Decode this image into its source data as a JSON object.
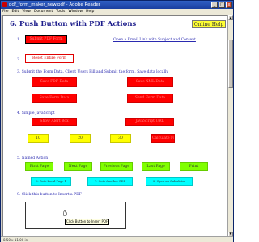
{
  "window": {
    "title": "pdf_form_maker_new.pdf - Adobe Reader",
    "min_label": "_",
    "max_label": "□",
    "close_label": "x"
  },
  "menubar": {
    "items": [
      "File",
      "Edit",
      "View",
      "Document",
      "Tools",
      "Window",
      "Help"
    ]
  },
  "heading": {
    "title": "6. Push Button with PDF Actions",
    "online_help": "Online Help"
  },
  "section1": {
    "num": "1.",
    "red_button_label": "Submit PDF Form",
    "email_link": "Open a Email Link with Subject and Content"
  },
  "section2": {
    "num": "2.",
    "reset_label": "Reset Entire Form"
  },
  "section3": {
    "text": "3. Submit the Form Data. Client Users Fill and Submit the form, Save data locally",
    "buttons": [
      "Save FDF Data",
      "Save XML Data",
      "Save Form Data",
      "Send Form Data"
    ]
  },
  "section4": {
    "text": "4. Simple JavaScript",
    "left_button": "Show Alert Box",
    "right_button": "JavaScript URL",
    "yellow_buttons": [
      "10",
      "20",
      "30"
    ],
    "right_button2": "Calculate Field"
  },
  "section5": {
    "text": "5. Named Action",
    "green_buttons": [
      "First Page",
      "Next Page",
      "Previous Page",
      "Last Page",
      "Print"
    ],
    "cyan_buttons": [
      "6. Goto Local Page 1",
      "7. Goto Another PDF",
      "8. Open an Calculator"
    ]
  },
  "section9": {
    "text": "9. Click this button to Insert a PDF",
    "tooltip": "Click Button to Insert PDF"
  },
  "statusbar": {
    "text": "8.50 x 11.00 in"
  }
}
